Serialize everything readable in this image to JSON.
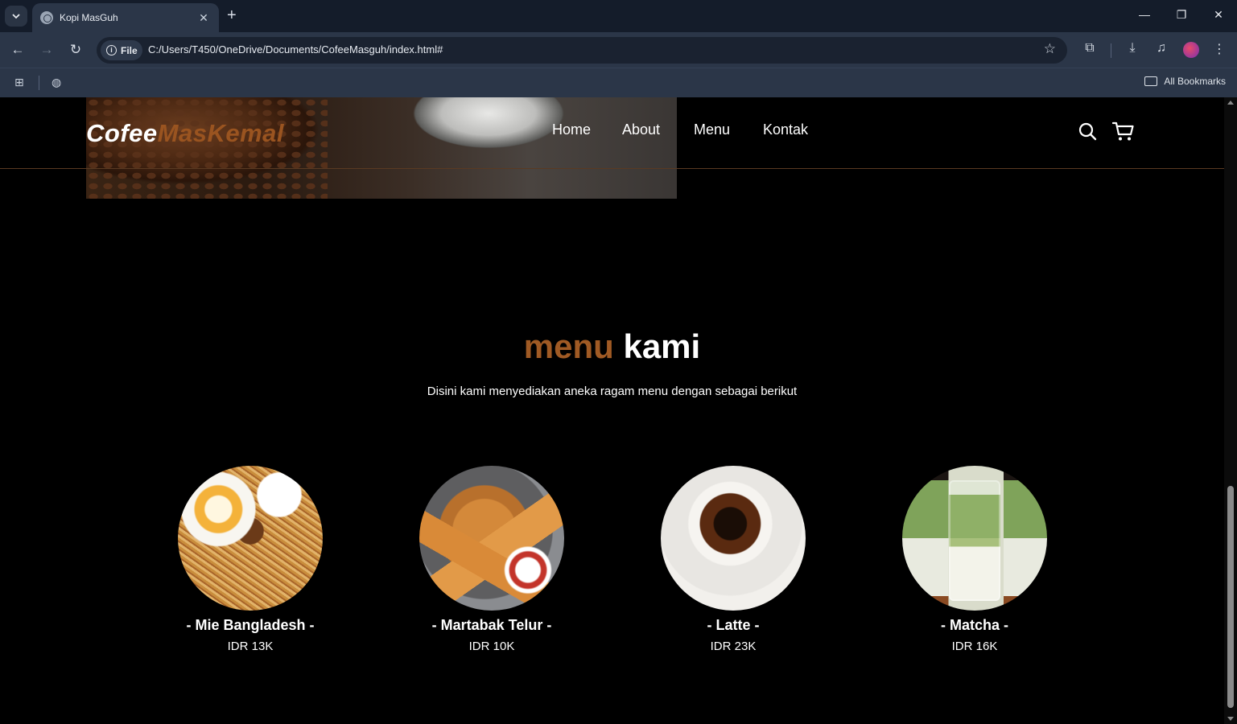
{
  "browser": {
    "tab_title": "Kopi MasGuh",
    "url": "C:/Users/T450/OneDrive/Documents/CofeeMasguh/index.html#",
    "scheme_chip": "File",
    "bookmarks_label": "All Bookmarks"
  },
  "site": {
    "logo_part1": "Cofee",
    "logo_part2": "MasKemal",
    "nav": [
      "Home",
      "About",
      "Menu",
      "Kontak"
    ]
  },
  "menu_section": {
    "title_accent": "menu",
    "title_plain": "kami",
    "subtitle": "Disini kami menyediakan aneka ragam menu dengan sebagai berikut",
    "items": [
      {
        "name": "- Mie Bangladesh -",
        "price": "IDR 13K"
      },
      {
        "name": "- Martabak Telur -",
        "price": "IDR 10K"
      },
      {
        "name": "- Latte -",
        "price": "IDR 23K"
      },
      {
        "name": "- Matcha -",
        "price": "IDR 16K"
      }
    ]
  },
  "colors": {
    "accent": "#a05a24",
    "chrome_bg": "#2b3648",
    "page_bg": "#000000"
  },
  "icons": [
    "tab-search-icon",
    "globe-icon",
    "close-icon",
    "plus-icon",
    "minimize-icon",
    "restore-icon",
    "back-icon",
    "forward-icon",
    "reload-icon",
    "info-icon",
    "star-icon",
    "extensions-icon",
    "download-icon",
    "media-icon",
    "menu-dots-icon",
    "apps-grid-icon",
    "folder-icon",
    "search-icon",
    "cart-icon"
  ]
}
